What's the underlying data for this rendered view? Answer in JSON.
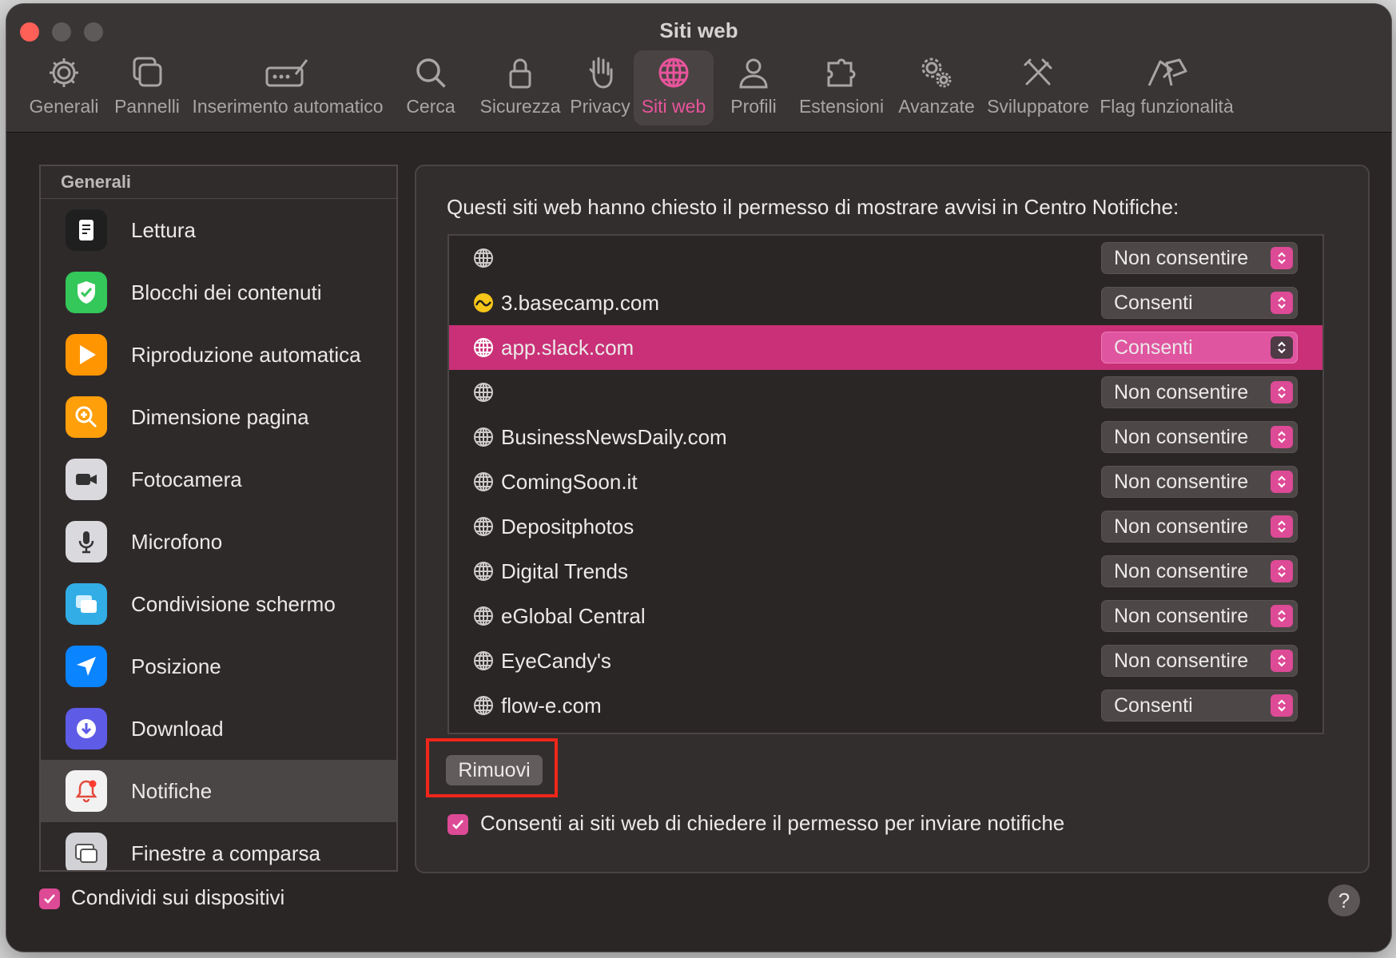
{
  "window": {
    "title": "Siti web",
    "help_label": "?"
  },
  "toolbar": [
    {
      "label": "Generali",
      "icon": "gear-icon"
    },
    {
      "label": "Pannelli",
      "icon": "tabs-icon"
    },
    {
      "label": "Inserimento automatico",
      "icon": "autofill-icon"
    },
    {
      "label": "Cerca",
      "icon": "search-icon"
    },
    {
      "label": "Sicurezza",
      "icon": "lock-icon"
    },
    {
      "label": "Privacy",
      "icon": "hand-icon"
    },
    {
      "label": "Siti web",
      "icon": "globe-icon",
      "active": true
    },
    {
      "label": "Profili",
      "icon": "person-icon"
    },
    {
      "label": "Estensioni",
      "icon": "puzzle-icon"
    },
    {
      "label": "Avanzate",
      "icon": "gears-icon"
    },
    {
      "label": "Sviluppatore",
      "icon": "tools-icon"
    },
    {
      "label": "Flag funzionalità",
      "icon": "flags-icon"
    }
  ],
  "sidebar": {
    "header": "Generali",
    "items": [
      {
        "label": "Lettura",
        "icon": "reader-icon",
        "color": "#1f1f1f"
      },
      {
        "label": "Blocchi dei contenuti",
        "icon": "shield-check-icon",
        "color": "#34c759"
      },
      {
        "label": "Riproduzione automatica",
        "icon": "play-icon",
        "color": "#ff9500"
      },
      {
        "label": "Dimensione pagina",
        "icon": "zoom-icon",
        "color": "#ff9f0a"
      },
      {
        "label": "Fotocamera",
        "icon": "camera-icon",
        "color": "#8e8e93"
      },
      {
        "label": "Microfono",
        "icon": "microphone-icon",
        "color": "#8e8e93"
      },
      {
        "label": "Condivisione schermo",
        "icon": "screen-share-icon",
        "color": "#32ade6"
      },
      {
        "label": "Posizione",
        "icon": "location-arrow-icon",
        "color": "#0a84ff"
      },
      {
        "label": "Download",
        "icon": "download-icon",
        "color": "#5e5ce6"
      },
      {
        "label": "Notifiche",
        "icon": "bell-icon",
        "color": "#f2f2f2",
        "selected": true
      },
      {
        "label": "Finestre a comparsa",
        "icon": "popup-window-icon",
        "color": "#d1d1d6"
      }
    ]
  },
  "main": {
    "description": "Questi siti web hanno chiesto il permesso di mostrare avvisi in Centro Notifiche:",
    "rows": [
      {
        "site": "",
        "value": "Non consentire",
        "icon": "globe-icon"
      },
      {
        "site": "3.basecamp.com",
        "value": "Consenti",
        "icon": "basecamp-icon"
      },
      {
        "site": "app.slack.com",
        "value": "Consenti",
        "icon": "globe-icon",
        "selected": true
      },
      {
        "site": "",
        "value": "Non consentire",
        "icon": "globe-icon"
      },
      {
        "site": "BusinessNewsDaily.com",
        "value": "Non consentire",
        "icon": "globe-icon"
      },
      {
        "site": "ComingSoon.it",
        "value": "Non consentire",
        "icon": "globe-icon"
      },
      {
        "site": "Depositphotos",
        "value": "Non consentire",
        "icon": "globe-icon"
      },
      {
        "site": "Digital Trends",
        "value": "Non consentire",
        "icon": "globe-icon"
      },
      {
        "site": "eGlobal Central",
        "value": "Non consentire",
        "icon": "globe-icon"
      },
      {
        "site": "EyeCandy's",
        "value": "Non consentire",
        "icon": "globe-icon"
      },
      {
        "site": "flow-e.com",
        "value": "Consenti",
        "icon": "globe-icon"
      }
    ],
    "remove_button": "Rimuovi",
    "allow_ask_label": "Consenti ai siti web di chiedere il permesso per inviare notifiche",
    "allow_ask_checked": true
  },
  "footer": {
    "share_label": "Condividi sui dispositivi",
    "share_checked": true
  },
  "colors": {
    "accent": "#dd4a96",
    "selected_row": "#c93077",
    "highlight_box": "#f0261a"
  }
}
